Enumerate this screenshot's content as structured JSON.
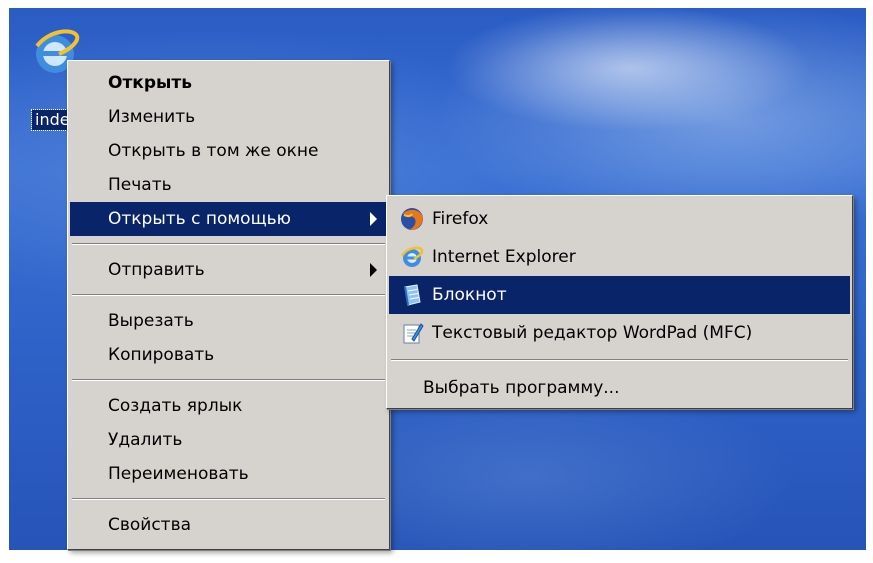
{
  "desktop": {
    "icon_label": "inde",
    "icon_name": "internet-explorer-html-file-icon"
  },
  "context_menu": {
    "items": [
      {
        "label": "Открыть",
        "bold": true
      },
      {
        "label": "Изменить"
      },
      {
        "label": "Открыть в том же окне"
      },
      {
        "label": "Печать"
      },
      {
        "label": "Открыть с помощью",
        "selected": true,
        "submenu": true
      },
      {
        "label": "Отправить",
        "submenu": true
      },
      {
        "label": "Вырезать"
      },
      {
        "label": "Копировать"
      },
      {
        "label": "Создать ярлык"
      },
      {
        "label": "Удалить"
      },
      {
        "label": "Переименовать"
      },
      {
        "label": "Свойства"
      }
    ]
  },
  "open_with_submenu": {
    "items": [
      {
        "label": "Firefox",
        "icon": "firefox-icon"
      },
      {
        "label": "Internet Explorer",
        "icon": "internet-explorer-icon"
      },
      {
        "label": "Блокнот",
        "icon": "notepad-icon",
        "selected": true
      },
      {
        "label": "Текстовый редактор WordPad (MFC)",
        "icon": "wordpad-icon"
      }
    ],
    "choose_program": "Выбрать программу..."
  },
  "colors": {
    "selection": "#0a246a",
    "menu_bg": "#d6d3ce",
    "desktop_blue": "#2f63c8"
  }
}
